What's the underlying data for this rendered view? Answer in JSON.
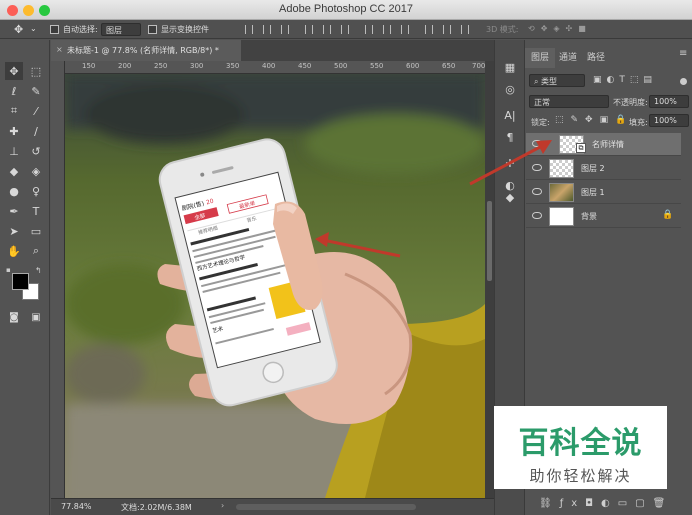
{
  "window": {
    "title": "Adobe Photoshop CC 2017"
  },
  "options_bar": {
    "auto_select_label": "自动选择:",
    "auto_select_value": "图层",
    "show_transform_label": "显示变换控件",
    "mode_3d_label": "3D 模式:"
  },
  "document": {
    "tab_title": "未标题-1 @ 77.8% (名师详情, RGB/8*) *",
    "ruler_ticks": [
      "150",
      "200",
      "250",
      "300",
      "350",
      "400",
      "450",
      "500",
      "550",
      "600",
      "650",
      "700"
    ],
    "zoom": "77.84%",
    "doc_info": "文档:2.02M/6.38M"
  },
  "phone_screen": {
    "header": "剧院(售)",
    "count": "20",
    "btn1": "全部",
    "btn2": "最新单",
    "tab1": "推荐明细",
    "tab2": "音乐",
    "item1": "西方艺术理论与哲学",
    "item2": "艺术"
  },
  "layers_panel": {
    "tabs": [
      "图层",
      "通道",
      "路径"
    ],
    "filter_label": "类型",
    "blend_mode": "正常",
    "opacity_label": "不透明度:",
    "opacity_value": "100%",
    "lock_label": "锁定:",
    "fill_label": "填充:",
    "fill_value": "100%",
    "layers": [
      {
        "name": "名师详情",
        "selected": true
      },
      {
        "name": "图层 2",
        "selected": false
      },
      {
        "name": "图层 1",
        "selected": false
      },
      {
        "name": "背景",
        "selected": false
      }
    ]
  },
  "watermark": {
    "title": "百科全说",
    "subtitle": "助你轻松解决"
  },
  "colors": {
    "accent_red": "#c0392b",
    "watermark_green": "#2b9b6a"
  }
}
